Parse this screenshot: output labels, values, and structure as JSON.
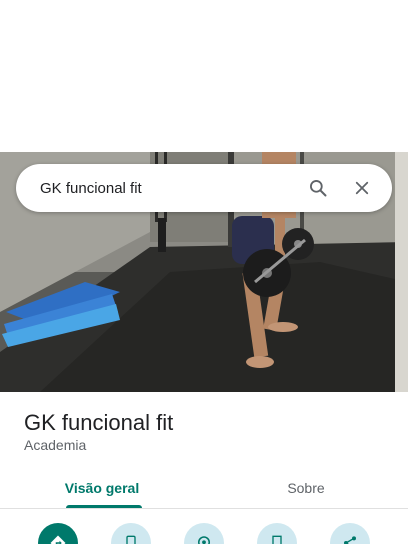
{
  "search": {
    "query": "GK funcional fit"
  },
  "place": {
    "name": "GK funcional fit",
    "category": "Academia"
  },
  "tabs": [
    {
      "label": "Visão geral"
    },
    {
      "label": "Sobre"
    }
  ],
  "actions": [
    {
      "icon": "directions-icon"
    },
    {
      "icon": "phone-icon"
    },
    {
      "icon": "location-icon"
    },
    {
      "icon": "save-icon"
    },
    {
      "icon": "share-icon"
    }
  ],
  "colors": {
    "accent": "#00796b",
    "secondary_button": "#cfe8f0"
  }
}
